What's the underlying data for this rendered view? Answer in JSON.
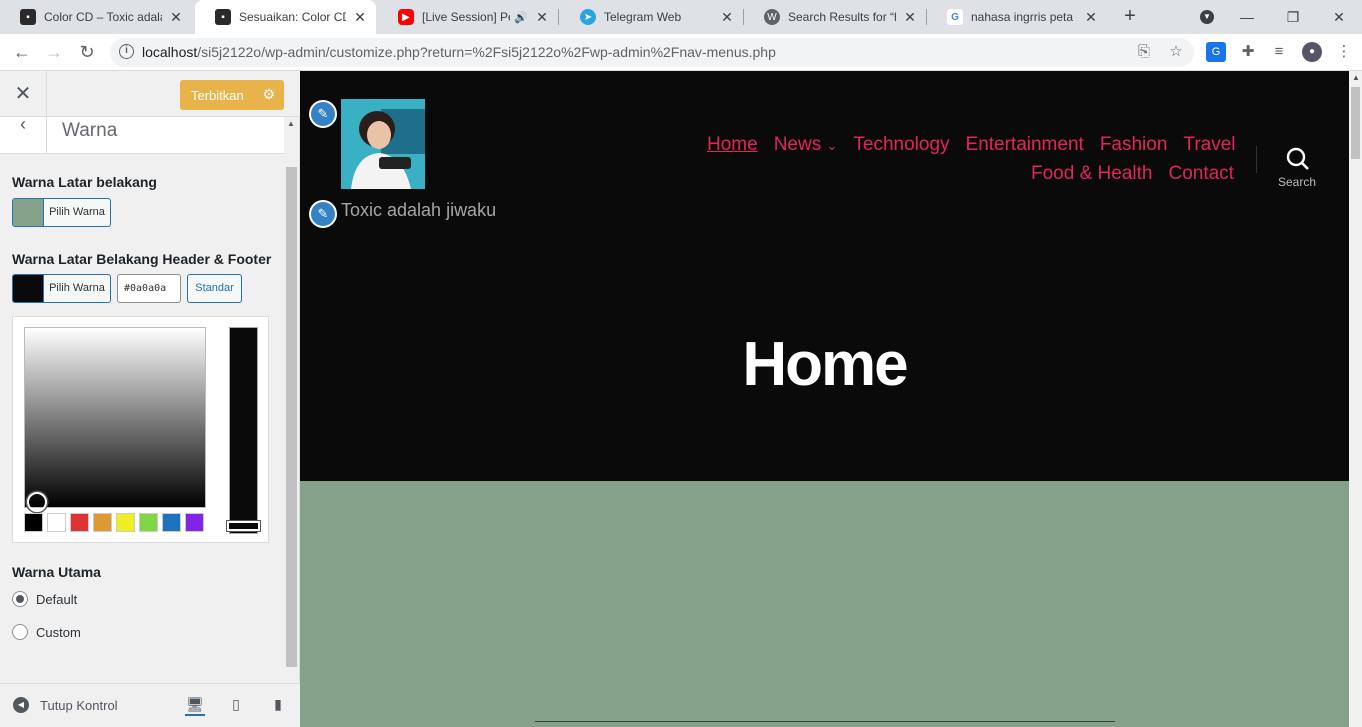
{
  "browser": {
    "tabs": [
      {
        "title": "Color CD – Toxic adalah jiwaku",
        "favicon": "wp-site-favicon",
        "active": false
      },
      {
        "title": "Sesuaikan: Color CD – Toxic adalah jiwaku",
        "favicon": "wp-site-favicon",
        "active": true
      },
      {
        "title": "[Live Session] Pertemuan",
        "favicon": "youtube-icon",
        "active": false,
        "audio": true
      },
      {
        "title": "Telegram Web",
        "favicon": "telegram-icon",
        "active": false
      },
      {
        "title": "Search Results for “header”",
        "favicon": "wordpress-icon",
        "active": false
      },
      {
        "title": "nahasa ingrris peta - Penelusuran",
        "favicon": "google-icon",
        "active": false
      }
    ],
    "url_host": "localhost",
    "url_path": "/si5j2122o/wp-admin/customize.php?return=%2Fsi5j2122o%2Fwp-admin%2Fnav-menus.php"
  },
  "customizer": {
    "publish_label": "Terbitkan",
    "section_title": "Warna",
    "bg_color_label": "Warna Latar belakang",
    "bg_color_value": "#84a18a",
    "pick_color_label": "Pilih Warna",
    "header_footer_label": "Warna Latar Belakang Header & Footer",
    "header_footer_value": "#0a0a0a",
    "header_footer_hex": "#0a0a0a",
    "default_btn_label": "Standar",
    "palette": [
      "#000000",
      "#ffffff",
      "#dd3333",
      "#dd9933",
      "#eeee22",
      "#81d742",
      "#1e73be",
      "#8224e3"
    ],
    "primary_color_label": "Warna Utama",
    "primary_options": [
      {
        "label": "Default",
        "checked": true
      },
      {
        "label": "Custom",
        "checked": false
      }
    ],
    "collapse_label": "Tutup Kontrol"
  },
  "preview": {
    "site_description": "Toxic adalah jiwaku",
    "menu_row1": [
      "Home",
      "News",
      "Technology",
      "Entertainment",
      "Fashion",
      "Travel"
    ],
    "menu_row2": [
      "Food & Health",
      "Contact"
    ],
    "search_label": "Search",
    "page_title": "Home",
    "accent_color": "#e22658"
  }
}
